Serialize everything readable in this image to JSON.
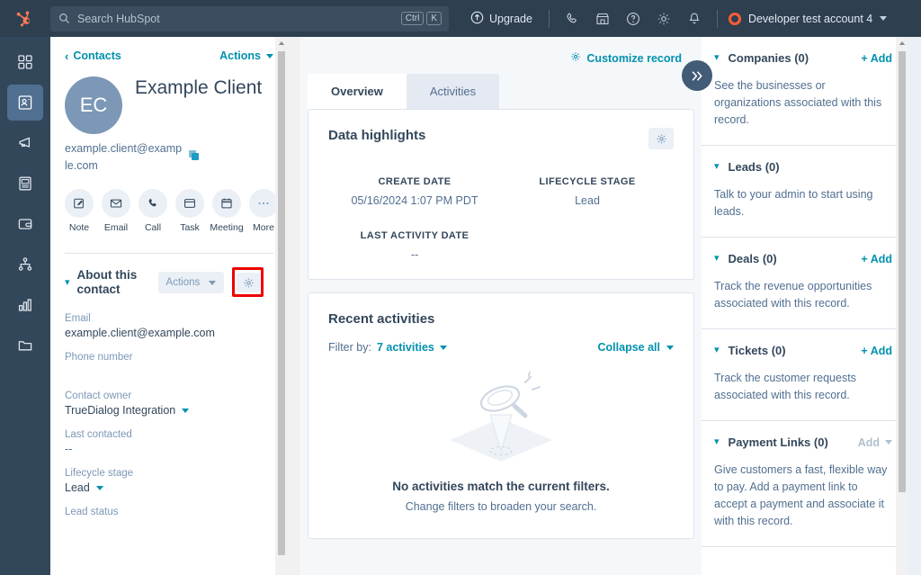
{
  "topnav": {
    "logo_icon": "hubspot-sprocket-logo",
    "search": {
      "placeholder": "Search HubSpot",
      "icon": "search-icon",
      "shortcut_ctrl": "Ctrl",
      "shortcut_key": "K"
    },
    "upgrade_label": "Upgrade",
    "upgrade_icon": "upgrade-arrow-icon",
    "icons": [
      "phone-icon",
      "marketplace-icon",
      "help-circle-icon",
      "gear-icon",
      "bell-icon"
    ],
    "account_label": "Developer test account 4",
    "account_icon": "account-ring-icon",
    "account_caret_icon": "chevron-down-icon"
  },
  "rail": {
    "items": [
      {
        "name": "dashboard",
        "icon": "grid-squares-icon",
        "active": false
      },
      {
        "name": "contacts",
        "icon": "contact-card-icon",
        "active": true
      },
      {
        "name": "marketing",
        "icon": "megaphone-icon",
        "active": false
      },
      {
        "name": "content",
        "icon": "content-page-icon",
        "active": false
      },
      {
        "name": "commerce",
        "icon": "wallet-icon",
        "active": false
      },
      {
        "name": "automation",
        "icon": "hierarchy-icon",
        "active": false
      },
      {
        "name": "reporting",
        "icon": "bar-chart-icon",
        "active": false
      },
      {
        "name": "library",
        "icon": "folder-icon",
        "active": false
      }
    ]
  },
  "left_panel": {
    "back_label": "Contacts",
    "back_icon": "chevron-left-icon",
    "actions_label": "Actions",
    "actions_caret_icon": "chevron-down-icon",
    "avatar_initials": "EC",
    "contact_name": "Example Client",
    "contact_email": "example.client@example.com",
    "copy_icon": "copy-icon",
    "quick_actions": [
      {
        "label": "Note",
        "icon": "note-pencil-icon"
      },
      {
        "label": "Email",
        "icon": "envelope-icon"
      },
      {
        "label": "Call",
        "icon": "phone-icon"
      },
      {
        "label": "Task",
        "icon": "task-window-icon"
      },
      {
        "label": "Meeting",
        "icon": "calendar-icon"
      },
      {
        "label": "More",
        "icon": "ellipsis-icon"
      }
    ],
    "about": {
      "collapse_icon": "chevron-down-icon",
      "title": "About this contact",
      "actions_label": "Actions",
      "actions_caret_icon": "chevron-down-icon",
      "gear_icon": "gear-icon",
      "gear_highlighted": true,
      "highlight_color": "#ee0000"
    },
    "properties": [
      {
        "label": "Email",
        "value": "example.client@example.com",
        "has_caret": false
      },
      {
        "label": "Phone number",
        "value": "",
        "has_caret": false
      },
      {
        "label": "Contact owner",
        "value": "TrueDialog Integration",
        "has_caret": true
      },
      {
        "label": "Last contacted",
        "value": "--",
        "has_caret": false
      },
      {
        "label": "Lifecycle stage",
        "value": "Lead",
        "has_caret": true
      },
      {
        "label": "Lead status",
        "value": "",
        "has_caret": false
      }
    ]
  },
  "center_panel": {
    "customize_label": "Customize record",
    "customize_icon": "gear-icon",
    "tabs": [
      {
        "label": "Overview",
        "active": true
      },
      {
        "label": "Activities",
        "active": false
      }
    ],
    "data_highlights": {
      "title": "Data highlights",
      "gear_icon": "gear-icon",
      "items": [
        {
          "label": "CREATE DATE",
          "value": "05/16/2024 1:07 PM PDT"
        },
        {
          "label": "LIFECYCLE STAGE",
          "value": "Lead"
        },
        {
          "label": "LAST ACTIVITY DATE",
          "value": "--"
        }
      ]
    },
    "recent_activities": {
      "title": "Recent activities",
      "filter_label": "Filter by:",
      "filter_value": "7 activities",
      "filter_caret_icon": "chevron-down-icon",
      "collapse_all_label": "Collapse all",
      "collapse_all_caret_icon": "chevron-down-icon",
      "empty_illustration_icon": "magnifying-glass-search-illustration",
      "empty_title": "No activities match the current filters.",
      "empty_subtitle": "Change filters to broaden your search."
    }
  },
  "right_panel": {
    "collapse_toggle_icon": "double-chevron-right-icon",
    "sections": [
      {
        "title": "Companies (0)",
        "collapse_icon": "chevron-down-icon",
        "add_label": "+ Add",
        "add_disabled": false,
        "body": "See the businesses or organizations associated with this record."
      },
      {
        "title": "Leads (0)",
        "collapse_icon": "chevron-down-icon",
        "add_label": "",
        "add_disabled": false,
        "body": "Talk to your admin to start using leads."
      },
      {
        "title": "Deals (0)",
        "collapse_icon": "chevron-down-icon",
        "add_label": "+ Add",
        "add_disabled": false,
        "body": "Track the revenue opportunities associated with this record."
      },
      {
        "title": "Tickets (0)",
        "collapse_icon": "chevron-down-icon",
        "add_label": "+ Add",
        "add_disabled": false,
        "body": "Track the customer requests associated with this record."
      },
      {
        "title": "Payment Links (0)",
        "collapse_icon": "chevron-down-icon",
        "add_label": "Add",
        "add_disabled": true,
        "body": "Give customers a fast, flexible way to pay. Add a payment link to accept a payment and associate it with this record."
      }
    ]
  },
  "colors": {
    "nav_bg": "#2e3f50",
    "rail_bg": "#33475b",
    "link_teal": "#0091ae",
    "brand_orange": "#ff5c35",
    "text_dark": "#33475b",
    "text_muted": "#516f90",
    "highlight_red": "#ee0000"
  }
}
